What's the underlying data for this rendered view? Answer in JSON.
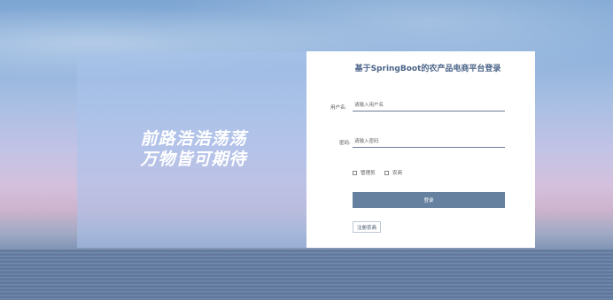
{
  "slogan": {
    "line1": "前路浩浩荡荡",
    "line2": "万物皆可期待"
  },
  "login": {
    "title": "基于SpringBoot的农产品电商平台登录",
    "username_label": "用户名:",
    "username_placeholder": "请输入用户名",
    "password_label": "密码:",
    "password_placeholder": "请输入密码",
    "roles": [
      "管理员",
      "农商"
    ],
    "login_button": "登录",
    "register_button": "注册农商"
  },
  "colors": {
    "accent": "#66809f",
    "title": "#4a6388"
  }
}
